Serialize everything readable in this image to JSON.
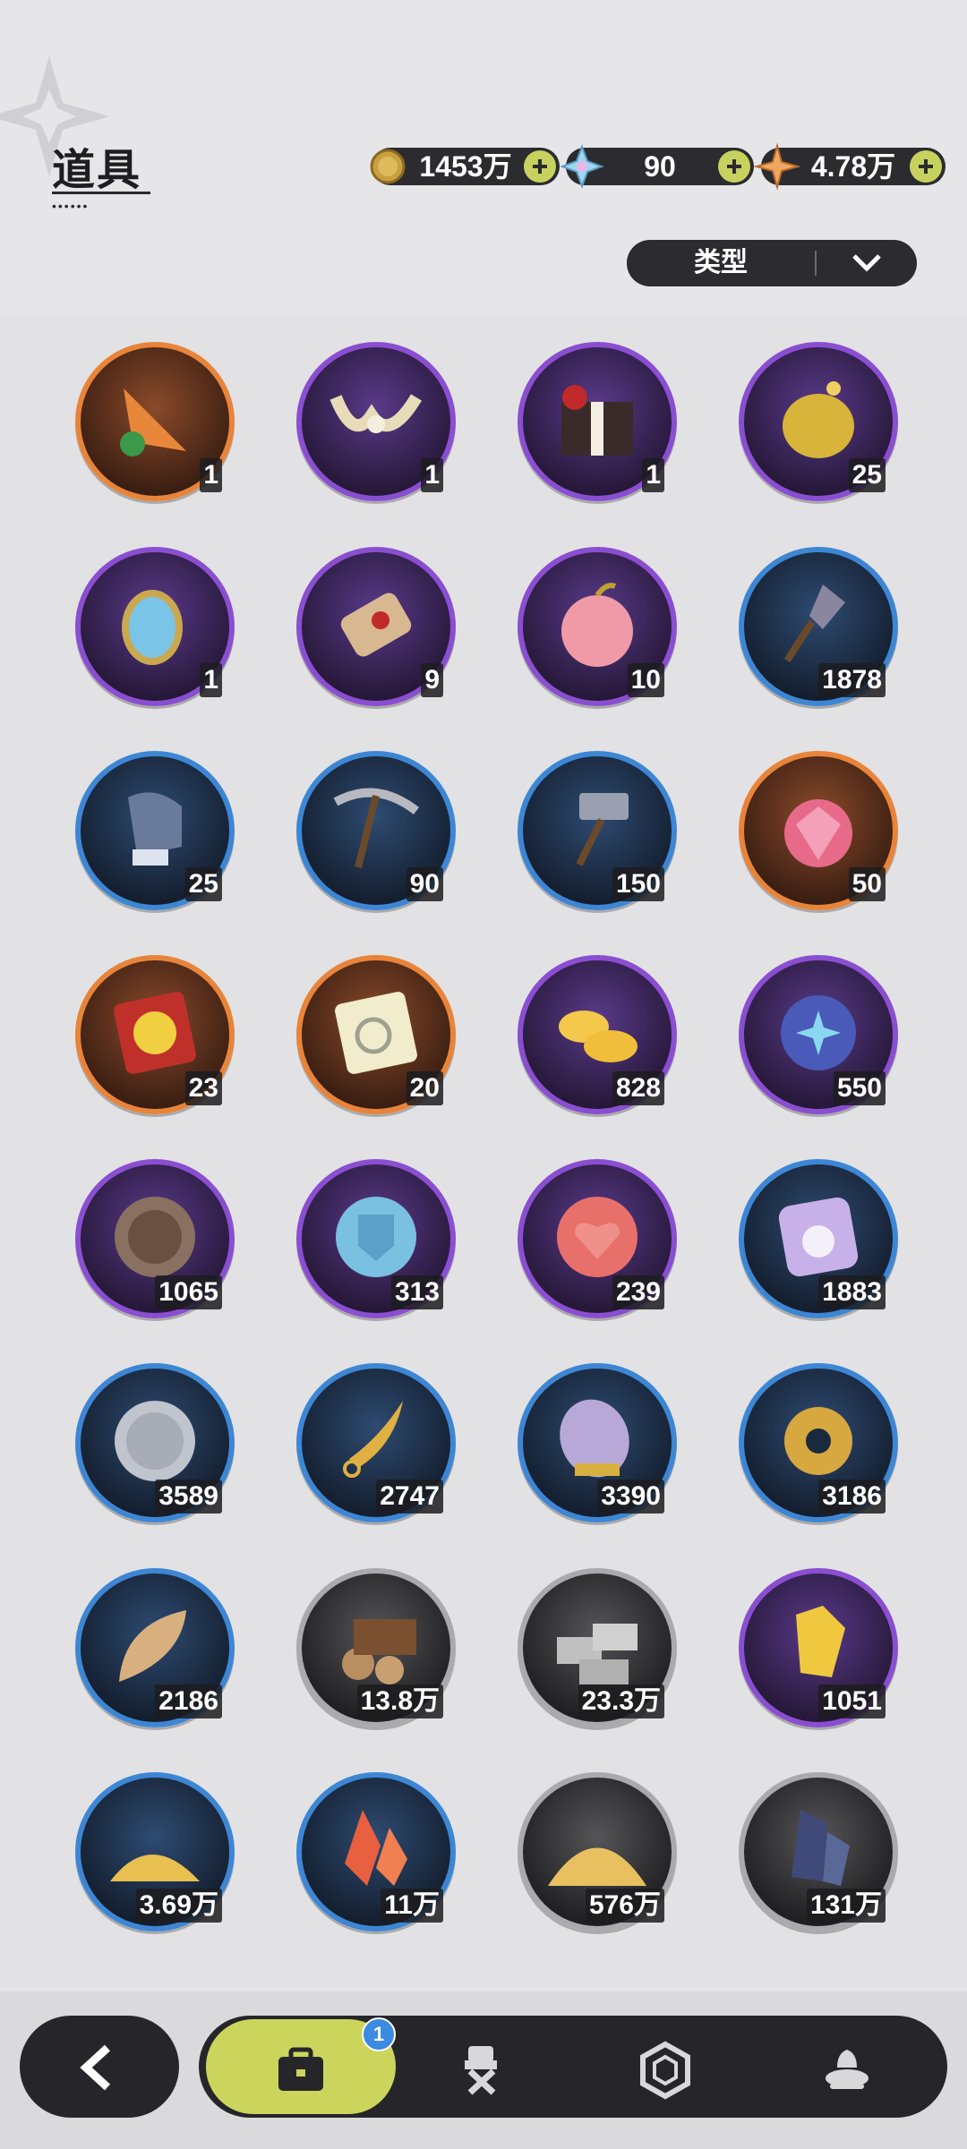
{
  "header": {
    "title": "道具",
    "currencies": [
      {
        "name": "gold-coin",
        "value": "1453万"
      },
      {
        "name": "star-crystal",
        "value": "90"
      },
      {
        "name": "four-point-star",
        "value": "4.78万"
      }
    ],
    "filter_label": "类型"
  },
  "items": [
    {
      "icon": "carrot-drill-icon",
      "count": "1",
      "rarity": "orange"
    },
    {
      "icon": "horn-ornament-icon",
      "count": "1",
      "rarity": "purple"
    },
    {
      "icon": "gift-box-icon",
      "count": "1",
      "rarity": "purple"
    },
    {
      "icon": "golden-egg-icon",
      "count": "25",
      "rarity": "purple"
    },
    {
      "icon": "magic-mirror-icon",
      "count": "1",
      "rarity": "purple"
    },
    {
      "icon": "scroll-icon",
      "count": "9",
      "rarity": "purple"
    },
    {
      "icon": "apple-icon",
      "count": "10",
      "rarity": "purple"
    },
    {
      "icon": "shovel-icon",
      "count": "1878",
      "rarity": "blue"
    },
    {
      "icon": "glove-icon",
      "count": "25",
      "rarity": "blue"
    },
    {
      "icon": "pickaxe-icon",
      "count": "90",
      "rarity": "blue"
    },
    {
      "icon": "hammer-icon",
      "count": "150",
      "rarity": "blue"
    },
    {
      "icon": "gem-apple-icon",
      "count": "50",
      "rarity": "orange"
    },
    {
      "icon": "roulette-ticket-icon",
      "count": "23",
      "rarity": "orange"
    },
    {
      "icon": "puzzle-ticket-icon",
      "count": "20",
      "rarity": "orange"
    },
    {
      "icon": "gold-ingot-icon",
      "count": "828",
      "rarity": "purple"
    },
    {
      "icon": "star-coin-icon",
      "count": "550",
      "rarity": "purple"
    },
    {
      "icon": "fist-coin-icon",
      "count": "1065",
      "rarity": "purple"
    },
    {
      "icon": "shield-coin-icon",
      "count": "313",
      "rarity": "purple"
    },
    {
      "icon": "heart-coin-icon",
      "count": "239",
      "rarity": "purple"
    },
    {
      "icon": "bunny-token-icon",
      "count": "1883",
      "rarity": "blue"
    },
    {
      "icon": "silver-coin-icon",
      "count": "3589",
      "rarity": "blue"
    },
    {
      "icon": "golden-blade-icon",
      "count": "2747",
      "rarity": "blue"
    },
    {
      "icon": "scale-shell-icon",
      "count": "3390",
      "rarity": "blue"
    },
    {
      "icon": "gear-icon",
      "count": "3186",
      "rarity": "blue"
    },
    {
      "icon": "leaf-icon",
      "count": "2186",
      "rarity": "blue"
    },
    {
      "icon": "wood-logs-icon",
      "count": "13.8万",
      "rarity": "gray"
    },
    {
      "icon": "stone-bricks-icon",
      "count": "23.3万",
      "rarity": "gray"
    },
    {
      "icon": "gold-crystal-icon",
      "count": "1051",
      "rarity": "purple"
    },
    {
      "icon": "gold-dust-icon",
      "count": "3.69万",
      "rarity": "blue"
    },
    {
      "icon": "red-crystal-icon",
      "count": "11万",
      "rarity": "blue"
    },
    {
      "icon": "sand-pile-icon",
      "count": "576万",
      "rarity": "gray"
    },
    {
      "icon": "dark-crystal-icon",
      "count": "131万",
      "rarity": "gray"
    }
  ],
  "nav": {
    "tabs": [
      "bag-icon",
      "chef-tool-icon",
      "hexagon-icon",
      "dessert-icon"
    ],
    "badge": "1"
  },
  "colors": {
    "orange": "#e8843a",
    "purple": "#8a4ed0",
    "blue": "#3d86d4",
    "gray": "#a9a9ae",
    "accent": "#cbd55c"
  }
}
